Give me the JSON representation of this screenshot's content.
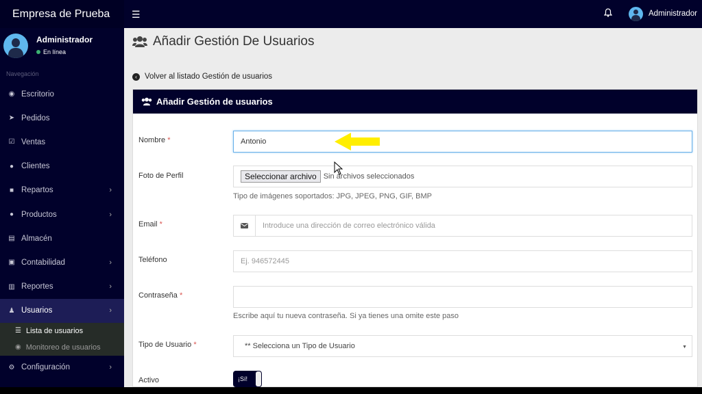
{
  "sidebar": {
    "brand": "Empresa de Prueba",
    "user": {
      "name": "Administrador",
      "status": "En línea"
    },
    "nav_header": "Navegación",
    "items": [
      {
        "label": "Escritorio",
        "icon": "dashboard-icon",
        "chevron": false
      },
      {
        "label": "Pedidos",
        "icon": "rocket-icon",
        "chevron": false
      },
      {
        "label": "Ventas",
        "icon": "check-square-icon",
        "chevron": false
      },
      {
        "label": "Clientes",
        "icon": "users-icon",
        "chevron": false
      },
      {
        "label": "Repartos",
        "icon": "truck-icon",
        "chevron": true
      },
      {
        "label": "Productos",
        "icon": "product-icon",
        "chevron": true
      },
      {
        "label": "Almacén",
        "icon": "file-icon",
        "chevron": false
      },
      {
        "label": "Contabilidad",
        "icon": "money-icon",
        "chevron": true
      },
      {
        "label": "Reportes",
        "icon": "bar-chart-icon",
        "chevron": true
      },
      {
        "label": "Usuarios",
        "icon": "user-icon",
        "chevron": true,
        "active": true
      }
    ],
    "submenu": [
      {
        "label": "Lista de usuarios",
        "icon": "list-icon"
      },
      {
        "label": "Monitoreo de usuarios",
        "icon": "eye-icon"
      }
    ],
    "after": {
      "label": "Configuración",
      "icon": "cogs-icon"
    }
  },
  "topbar": {
    "hamburger": "☰",
    "user": "Administrador"
  },
  "page": {
    "title": "Añadir Gestión De Usuarios",
    "back_link": "Volver al listado Gestión de usuarios"
  },
  "form": {
    "panel_title": "Añadir Gestión de usuarios",
    "nombre": {
      "label": "Nombre",
      "required": "*",
      "value": "Antonio"
    },
    "foto": {
      "label": "Foto de Perfil",
      "button": "Seleccionar archivo",
      "status": "Sin archivos seleccionados",
      "help": "Tipo de imágenes soportados: JPG, JPEG, PNG, GIF, BMP"
    },
    "email": {
      "label": "Email",
      "required": "*",
      "placeholder": "Introduce una dirección de correo electrónico válida"
    },
    "telefono": {
      "label": "Teléfono",
      "placeholder": "Ej. 946572445"
    },
    "password": {
      "label": "Contraseña",
      "required": "*",
      "help": "Escribe aquí tu nueva contraseña. Si ya tienes una omite este paso"
    },
    "tipo": {
      "label": "Tipo de Usuario",
      "required": "*",
      "selected": "** Selecciona un Tipo de Usuario"
    },
    "activo": {
      "label": "Activo",
      "toggle": "¡Sí!"
    }
  },
  "colors": {
    "nav_bg": "#01012b",
    "accent": "#66afe9",
    "arrow": "#ffee00",
    "online": "#3cb371"
  }
}
